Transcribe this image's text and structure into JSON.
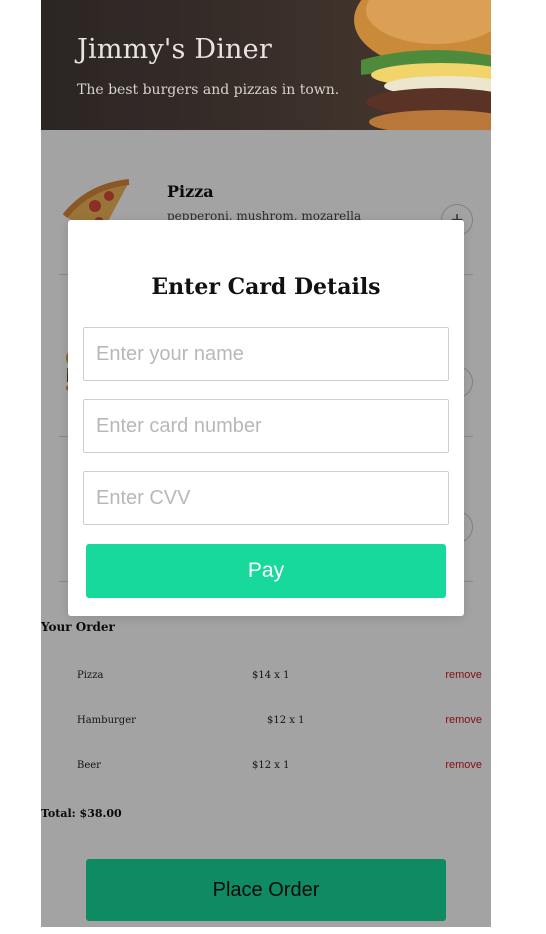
{
  "header": {
    "title": "Jimmy's Diner",
    "subtitle": "The best burgers and pizzas in town."
  },
  "menu": {
    "items": [
      {
        "name": "Pizza",
        "description": "pepperoni, mushrom, mozarella",
        "add_label": "+"
      },
      {
        "name": "",
        "description": "",
        "add_label": "+"
      },
      {
        "name": "",
        "description": "",
        "add_label": "+"
      }
    ]
  },
  "order": {
    "heading": "Your Order",
    "rows": [
      {
        "name": "Pizza",
        "price": "$14 x 1",
        "remove_label": "remove"
      },
      {
        "name": "Hamburger",
        "price": "$12 x 1",
        "remove_label": "remove"
      },
      {
        "name": "Beer",
        "price": "$12 x 1",
        "remove_label": "remove"
      }
    ],
    "total": "Total: $38.00",
    "place_order_label": "Place Order"
  },
  "modal": {
    "title": "Enter Card Details",
    "name_placeholder": "Enter your name",
    "card_placeholder": "Enter card number",
    "cvv_placeholder": "Enter CVV",
    "pay_label": "Pay"
  },
  "colors": {
    "accent": "#16d99b",
    "remove": "#d01919",
    "overlay": "rgba(0,0,0,0.36)"
  }
}
